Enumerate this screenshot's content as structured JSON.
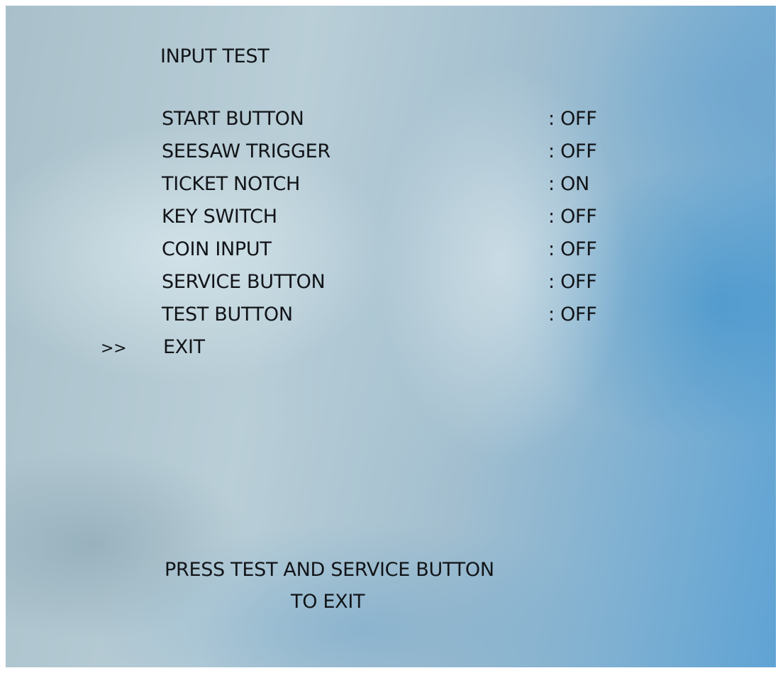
{
  "screen": {
    "title": "INPUT TEST",
    "items": [
      {
        "label": "START BUTTON",
        "value": ": OFF"
      },
      {
        "label": "SEESAW TRIGGER",
        "value": ": OFF"
      },
      {
        "label": "TICKET NOTCH",
        "value": ": ON"
      },
      {
        "label": "KEY SWITCH",
        "value": ": OFF"
      },
      {
        "label": "COIN INPUT",
        "value": ": OFF"
      },
      {
        "label": "SERVICE BUTTON",
        "value": ": OFF"
      },
      {
        "label": "TEST BUTTON",
        "value": ": OFF"
      }
    ],
    "cursor": ">>",
    "exit_label": "EXIT",
    "footer_line1": "PRESS TEST AND SERVICE BUTTON",
    "footer_line2": "TO EXIT"
  },
  "colors": {
    "text": "#111418",
    "background_left": "#b9ced7",
    "background_right": "#5fa3d4"
  }
}
